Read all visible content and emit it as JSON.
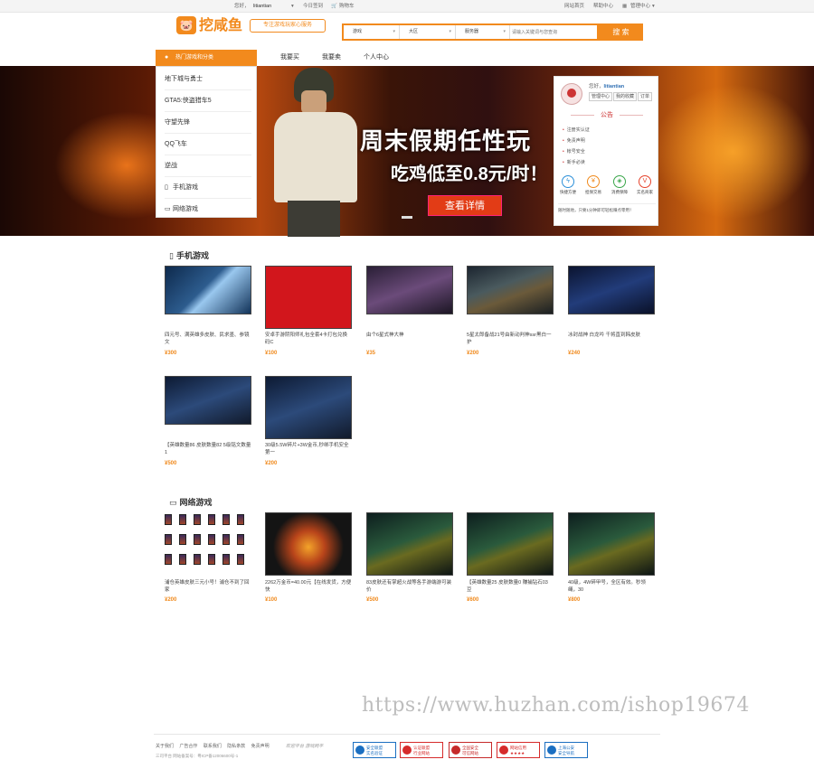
{
  "topbar": {
    "greeting": "您好，",
    "username": "litiantian",
    "today_checkin": "今日签到",
    "cart": "购物车",
    "home": "网站首页",
    "help": "帮助中心",
    "manage": "管理中心"
  },
  "brand": {
    "logo_text": "挖咸鱼",
    "slogan": "专注游戏玩家心服务"
  },
  "search": {
    "select_game": "游戏",
    "select_region": "大区",
    "select_server": "服务器",
    "placeholder": "请输入关键词与您查询",
    "button": "搜 索"
  },
  "nav": {
    "category_header": "热门游戏和分类",
    "links": [
      "我要买",
      "我要卖",
      "个人中心"
    ]
  },
  "categories": [
    "地下城与勇士",
    "GTA5:侠盗猎车5",
    "守望先锋",
    "QQ飞车",
    "逆战",
    "手机游戏",
    "网络游戏"
  ],
  "banner": {
    "headline": "周末假期任性玩",
    "subline": "吃鸡低至0.8元/时！",
    "cta": "查看详情"
  },
  "user_panel": {
    "hello": "您好，",
    "username": "litiantian",
    "buttons": [
      "管理中心",
      "我的收藏",
      "订单"
    ],
    "notice_title": "公告",
    "notices": [
      "注册实认证",
      "免责声明",
      "帐号安全",
      "新手必读"
    ],
    "services": [
      {
        "icon": "lightning-icon",
        "label": "快捷方便",
        "color": "#2b8fd8"
      },
      {
        "icon": "yen-icon",
        "label": "担保交易",
        "color": "#f08a1d"
      },
      {
        "icon": "shield-icon",
        "label": "消费保障",
        "color": "#3aa64a"
      },
      {
        "icon": "v-icon",
        "label": "实名商家",
        "color": "#e5432c"
      }
    ],
    "ticker": "随时随地，只要1分钟即可轻松赚点零用！"
  },
  "sections": [
    {
      "title": "手机游戏",
      "icon": "phone-icon",
      "items": [
        {
          "title": "四元号、满英雄多皮肤、民求墨、参镜文",
          "price": "¥300",
          "thumb": "t-blue"
        },
        {
          "title": "安卓手游阴阳师礼包全套4卡打包兑换码C",
          "price": "¥100",
          "thumb": "t-red"
        },
        {
          "title": "由个6星式神大神",
          "price": "¥35",
          "thumb": "t-dark"
        },
        {
          "title": "5星太郎备战21号由新动判神ssr黑白一护",
          "price": "¥200",
          "thumb": "t-brown"
        },
        {
          "title": "冰封战神 白龙吟 千将直到韩皮肤",
          "price": "¥240",
          "thumb": "t-navy"
        },
        {
          "title": "【英雄数量86 皮肤数量82 5级铭文数量1",
          "price": "¥500",
          "thumb": "t-moba"
        },
        {
          "title": "30级5.5W碎片+3W金币,秒绑手机安全第一",
          "price": "¥200",
          "thumb": "t-moba"
        }
      ]
    },
    {
      "title": "网络游戏",
      "icon": "monitor-icon",
      "items": [
        {
          "title": "浦仓英雄皮肤三元小号！浦仓不到了回家",
          "price": "¥200",
          "thumb": "t-grid"
        },
        {
          "title": "2262万金币=40.00元【在线发货，方便快",
          "price": "¥100",
          "thumb": "t-dnf"
        },
        {
          "title": "83皮肤还有掌超火战等各手游端游可装价",
          "price": "¥500",
          "thumb": "t-jx"
        },
        {
          "title": "【英雄数量25 皮肤数量0 赚捕钻石03 豆",
          "price": "¥600",
          "thumb": "t-jx"
        },
        {
          "title": "40级，4W碎甲号，全区有效。秒领绳，30",
          "price": "¥800",
          "thumb": "t-jx"
        }
      ]
    }
  ],
  "footer": {
    "links": [
      "关于我们",
      "广告合作",
      "联系我们",
      "隐私条款",
      "免责声明"
    ],
    "promo": "欢迎平台 游戏网平",
    "copyright": "三司平台 网站备案号：粤ICP备12006600号-1",
    "badges": [
      {
        "label": "安全联盟\n实名验证",
        "color": "#1b6fc1"
      },
      {
        "label": "认证联盟\n行业网站",
        "color": "#d62b2b"
      },
      {
        "label": "全国安全\n可信网站",
        "color": "#c62a2a"
      },
      {
        "label": "网站信用\n★★★★",
        "color": "#d62b2b"
      },
      {
        "label": "上海公安\n安全导航",
        "color": "#1b6fc1"
      }
    ]
  },
  "watermark": "https://www.huzhan.com/ishop19674"
}
